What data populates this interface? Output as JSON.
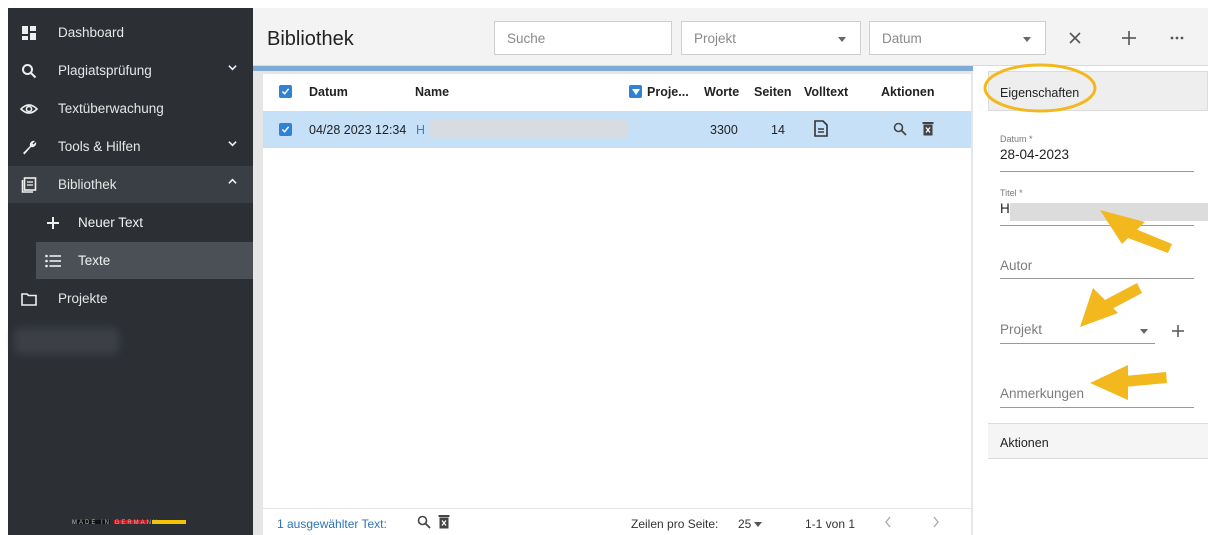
{
  "colors": {
    "sidebar_bg": "#2c3035",
    "accent_blue": "#2f82d6",
    "selected_row": "#c6e0f7",
    "annotation_yellow": "#f3b81e"
  },
  "sidebar": {
    "items": [
      {
        "label": "Dashboard",
        "icon": "dashboard-icon"
      },
      {
        "label": "Plagiatsprüfung",
        "icon": "search-icon",
        "chevron": "down"
      },
      {
        "label": "Textüberwachung",
        "icon": "eye-icon"
      },
      {
        "label": "Tools & Hilfen",
        "icon": "wrench-icon",
        "chevron": "down"
      },
      {
        "label": "Bibliothek",
        "icon": "library-icon",
        "chevron": "up"
      },
      {
        "label": "Neuer Text",
        "icon": "plus-icon"
      },
      {
        "label": "Texte",
        "icon": "list-icon"
      },
      {
        "label": "Projekte",
        "icon": "folder-icon"
      }
    ],
    "footer": "MADE IN GERMANY"
  },
  "header": {
    "title": "Bibliothek",
    "search_placeholder": "Suche",
    "project_placeholder": "Projekt",
    "date_placeholder": "Datum"
  },
  "table": {
    "columns": [
      "Datum",
      "Name",
      "Proje...",
      "Worte",
      "Seiten",
      "Volltext",
      "Aktionen"
    ],
    "rows": [
      {
        "datum": "04/28 2023 12:34",
        "name": "H",
        "worte": "3300",
        "seiten": "14"
      }
    ],
    "footer": {
      "selected_text": "1 ausgewählter Text:",
      "rows_per_page_label": "Zeilen pro Seite:",
      "rows_per_page": "25",
      "range": "1-1 von 1"
    }
  },
  "properties": {
    "header": "Eigenschaften",
    "datum_label": "Datum *",
    "datum_value": "28-04-2023",
    "titel_label": "Titel *",
    "titel_value": "H",
    "autor_placeholder": "Autor",
    "projekt_placeholder": "Projekt",
    "anmerkungen_placeholder": "Anmerkungen",
    "actions_label": "Aktionen"
  }
}
